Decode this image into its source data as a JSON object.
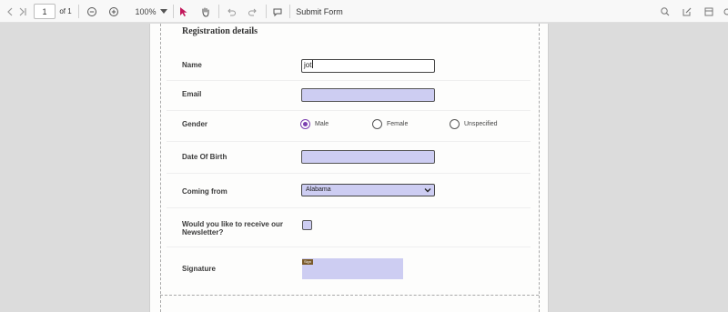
{
  "toolbar": {
    "page_value": "1",
    "page_total": "of 1",
    "zoom": "100%",
    "submit_label": "Submit Form"
  },
  "form": {
    "title": "Registration details",
    "name_label": "Name",
    "name_value": "jot",
    "email_label": "Email",
    "gender_label": "Gender",
    "gender_options": [
      "Male",
      "Female",
      "Unspecified"
    ],
    "gender_selected": "Male",
    "dob_label": "Date Of Birth",
    "coming_from_label": "Coming from",
    "coming_from_value": "Alabama",
    "newsletter_label_line1": "Would you like to receive our",
    "newsletter_label_line2": "Newsletter?",
    "signature_label": "Signature",
    "signature_tag": "Sign"
  },
  "colors": {
    "field_fill": "#cdcdf2",
    "accent": "#7b3fb0",
    "toolbar_bg": "#f8f8f8",
    "viewer_bg": "#dcdcdc"
  }
}
